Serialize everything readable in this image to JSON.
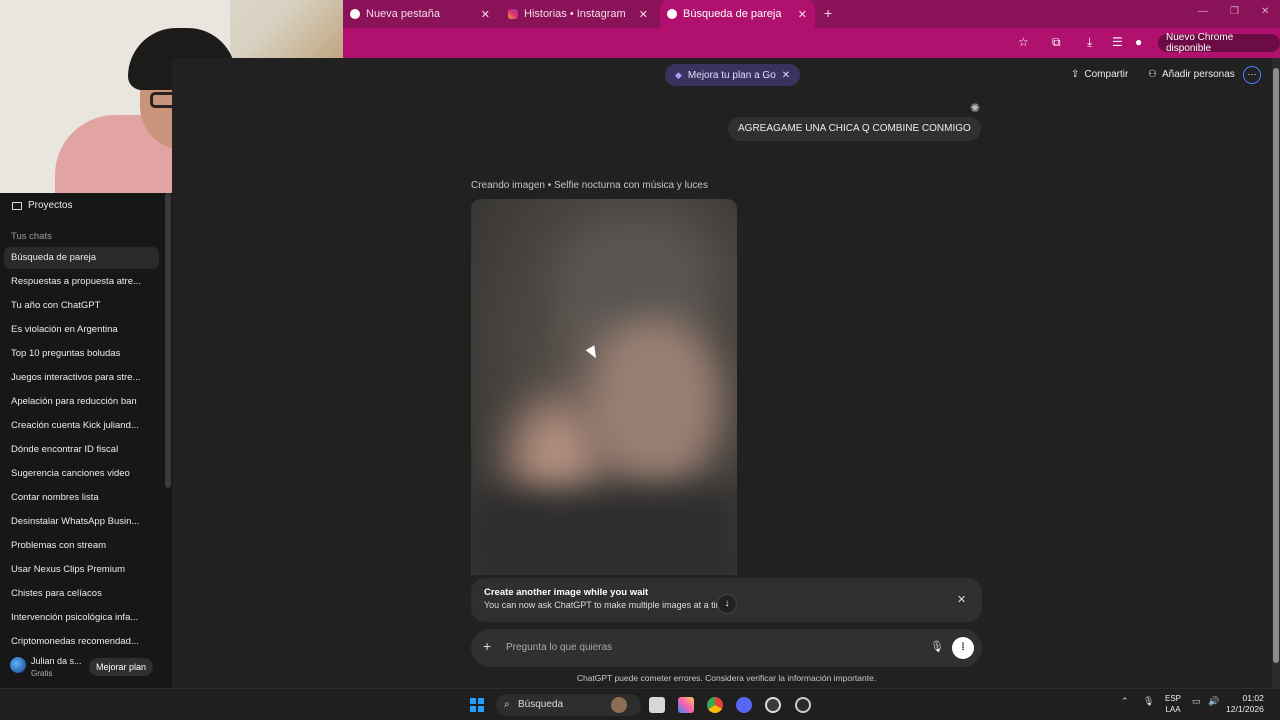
{
  "browser": {
    "tabs": [
      {
        "title": "Nueva pestaña",
        "favicon": "chrome-icon"
      },
      {
        "title": "Historias • Instagram",
        "favicon": "instagram-icon"
      },
      {
        "title": "Búsqueda de pareja",
        "favicon": "chatgpt-icon",
        "active": true
      }
    ],
    "update_label": "Nuevo Chrome disponible",
    "accent": "#b0106e"
  },
  "sidebar": {
    "projects_label": "Proyectos",
    "section_label": "Tus chats",
    "chats": [
      "Búsqueda de pareja",
      "Respuestas a propuesta atre...",
      "Tu año con ChatGPT",
      "Es violación en Argentina",
      "Top 10 preguntas boludas",
      "Juegos interactivos para stre...",
      "Apelación para reducción ban",
      "Creación cuenta Kick juliand...",
      "Dónde encontrar ID fiscal",
      "Sugerencia canciones video",
      "Contar nombres lista",
      "Desinstalar WhatsApp Busin...",
      "Problemas con stream",
      "Usar Nexus Clips Premium",
      "Chistes para celíacos",
      "Intervención psicológica infa...",
      "Criptomonedas recomendad..."
    ],
    "user": {
      "name": "Julian da s...",
      "plan": "Gratis",
      "upgrade_label": "Mejorar plan"
    }
  },
  "header": {
    "plan_pill": "Mejora tu plan a Go",
    "share_label": "Compartir",
    "add_people_label": "Añadir personas"
  },
  "conversation": {
    "user_message": "AGREAGAME UNA CHICA Q COMBINE CONMIGO",
    "creating_label": "Creando imagen • Selfie nocturna con música y luces"
  },
  "toast": {
    "title": "Create another image while you wait",
    "text": "You can now ask ChatGPT to make multiple images at a time"
  },
  "composer": {
    "placeholder": "Pregunta lo que quieras"
  },
  "disclaimer": "ChatGPT puede cometer errores. Considera verificar la información importante.",
  "taskbar": {
    "search_label": "Búsqueda",
    "lang_top": "ESP",
    "lang_bottom": "LAA",
    "time": "01:02",
    "date": "12/1/2026"
  }
}
